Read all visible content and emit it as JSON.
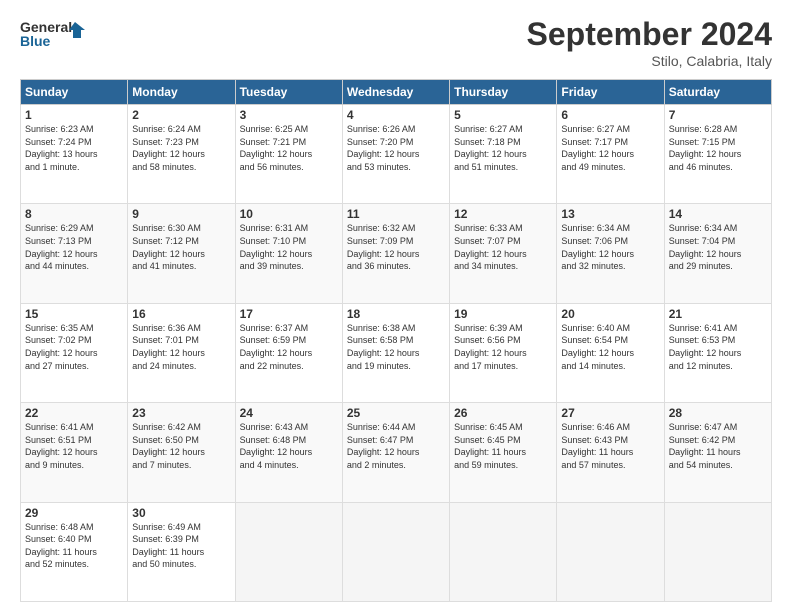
{
  "header": {
    "logo_line1": "General",
    "logo_line2": "Blue",
    "month": "September 2024",
    "location": "Stilo, Calabria, Italy"
  },
  "weekdays": [
    "Sunday",
    "Monday",
    "Tuesday",
    "Wednesday",
    "Thursday",
    "Friday",
    "Saturday"
  ],
  "weeks": [
    [
      {
        "day": "1",
        "info": "Sunrise: 6:23 AM\nSunset: 7:24 PM\nDaylight: 13 hours\nand 1 minute."
      },
      {
        "day": "2",
        "info": "Sunrise: 6:24 AM\nSunset: 7:23 PM\nDaylight: 12 hours\nand 58 minutes."
      },
      {
        "day": "3",
        "info": "Sunrise: 6:25 AM\nSunset: 7:21 PM\nDaylight: 12 hours\nand 56 minutes."
      },
      {
        "day": "4",
        "info": "Sunrise: 6:26 AM\nSunset: 7:20 PM\nDaylight: 12 hours\nand 53 minutes."
      },
      {
        "day": "5",
        "info": "Sunrise: 6:27 AM\nSunset: 7:18 PM\nDaylight: 12 hours\nand 51 minutes."
      },
      {
        "day": "6",
        "info": "Sunrise: 6:27 AM\nSunset: 7:17 PM\nDaylight: 12 hours\nand 49 minutes."
      },
      {
        "day": "7",
        "info": "Sunrise: 6:28 AM\nSunset: 7:15 PM\nDaylight: 12 hours\nand 46 minutes."
      }
    ],
    [
      {
        "day": "8",
        "info": "Sunrise: 6:29 AM\nSunset: 7:13 PM\nDaylight: 12 hours\nand 44 minutes."
      },
      {
        "day": "9",
        "info": "Sunrise: 6:30 AM\nSunset: 7:12 PM\nDaylight: 12 hours\nand 41 minutes."
      },
      {
        "day": "10",
        "info": "Sunrise: 6:31 AM\nSunset: 7:10 PM\nDaylight: 12 hours\nand 39 minutes."
      },
      {
        "day": "11",
        "info": "Sunrise: 6:32 AM\nSunset: 7:09 PM\nDaylight: 12 hours\nand 36 minutes."
      },
      {
        "day": "12",
        "info": "Sunrise: 6:33 AM\nSunset: 7:07 PM\nDaylight: 12 hours\nand 34 minutes."
      },
      {
        "day": "13",
        "info": "Sunrise: 6:34 AM\nSunset: 7:06 PM\nDaylight: 12 hours\nand 32 minutes."
      },
      {
        "day": "14",
        "info": "Sunrise: 6:34 AM\nSunset: 7:04 PM\nDaylight: 12 hours\nand 29 minutes."
      }
    ],
    [
      {
        "day": "15",
        "info": "Sunrise: 6:35 AM\nSunset: 7:02 PM\nDaylight: 12 hours\nand 27 minutes."
      },
      {
        "day": "16",
        "info": "Sunrise: 6:36 AM\nSunset: 7:01 PM\nDaylight: 12 hours\nand 24 minutes."
      },
      {
        "day": "17",
        "info": "Sunrise: 6:37 AM\nSunset: 6:59 PM\nDaylight: 12 hours\nand 22 minutes."
      },
      {
        "day": "18",
        "info": "Sunrise: 6:38 AM\nSunset: 6:58 PM\nDaylight: 12 hours\nand 19 minutes."
      },
      {
        "day": "19",
        "info": "Sunrise: 6:39 AM\nSunset: 6:56 PM\nDaylight: 12 hours\nand 17 minutes."
      },
      {
        "day": "20",
        "info": "Sunrise: 6:40 AM\nSunset: 6:54 PM\nDaylight: 12 hours\nand 14 minutes."
      },
      {
        "day": "21",
        "info": "Sunrise: 6:41 AM\nSunset: 6:53 PM\nDaylight: 12 hours\nand 12 minutes."
      }
    ],
    [
      {
        "day": "22",
        "info": "Sunrise: 6:41 AM\nSunset: 6:51 PM\nDaylight: 12 hours\nand 9 minutes."
      },
      {
        "day": "23",
        "info": "Sunrise: 6:42 AM\nSunset: 6:50 PM\nDaylight: 12 hours\nand 7 minutes."
      },
      {
        "day": "24",
        "info": "Sunrise: 6:43 AM\nSunset: 6:48 PM\nDaylight: 12 hours\nand 4 minutes."
      },
      {
        "day": "25",
        "info": "Sunrise: 6:44 AM\nSunset: 6:47 PM\nDaylight: 12 hours\nand 2 minutes."
      },
      {
        "day": "26",
        "info": "Sunrise: 6:45 AM\nSunset: 6:45 PM\nDaylight: 11 hours\nand 59 minutes."
      },
      {
        "day": "27",
        "info": "Sunrise: 6:46 AM\nSunset: 6:43 PM\nDaylight: 11 hours\nand 57 minutes."
      },
      {
        "day": "28",
        "info": "Sunrise: 6:47 AM\nSunset: 6:42 PM\nDaylight: 11 hours\nand 54 minutes."
      }
    ],
    [
      {
        "day": "29",
        "info": "Sunrise: 6:48 AM\nSunset: 6:40 PM\nDaylight: 11 hours\nand 52 minutes."
      },
      {
        "day": "30",
        "info": "Sunrise: 6:49 AM\nSunset: 6:39 PM\nDaylight: 11 hours\nand 50 minutes."
      },
      null,
      null,
      null,
      null,
      null
    ]
  ]
}
